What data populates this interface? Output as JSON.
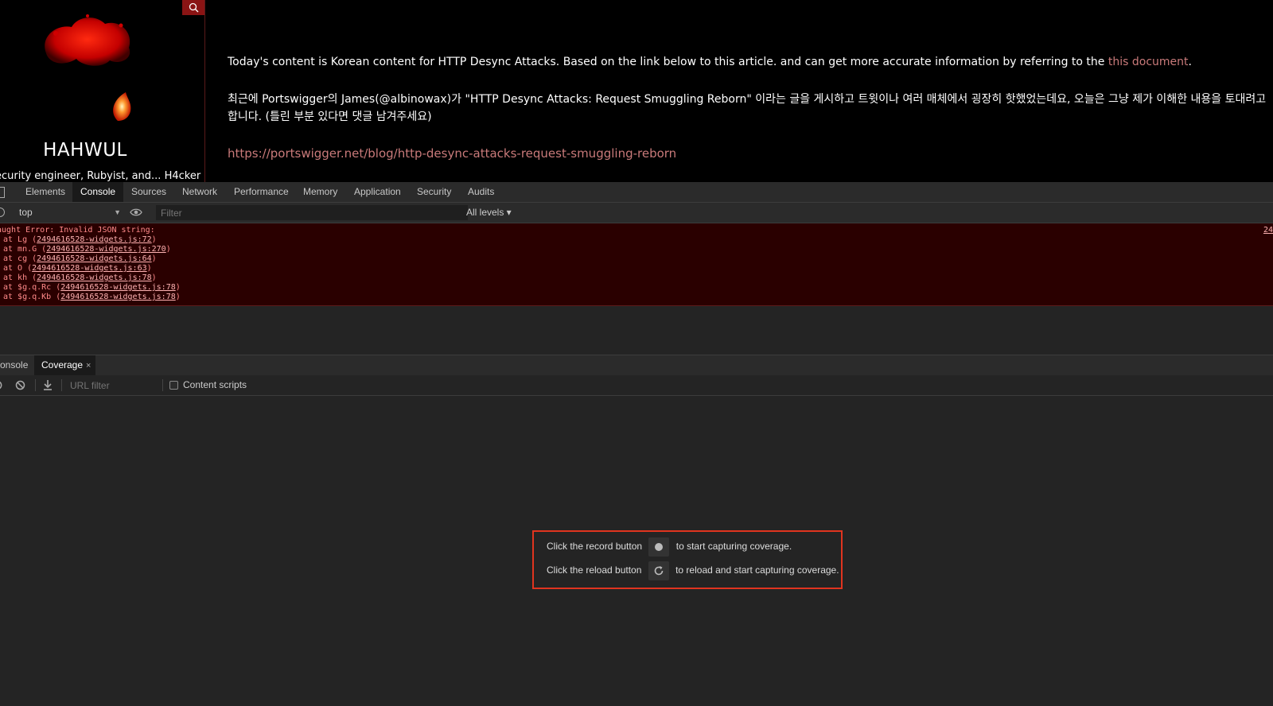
{
  "site": {
    "name": "HAHWUL",
    "tagline": "ecurity engineer, Rubyist, and... H4cker",
    "intro": "Today's content is Korean content for HTTP Desync Attacks. Based on the link below to this article. and can get more accurate information by referring to the",
    "intro_link": "this document",
    "intro_end": ".",
    "korean": "최근에 Portswigger의 James(@albinowax)가 \"HTTP Desync Attacks: Request Smuggling Reborn\" 이라는 글을 게시하고 트윗이나 여러 매체에서 굉장히 핫했었는데요, 오늘은 그냥 제가 이해한 내용을 토대려고 합니다. (틀린 부분 있다면 댓글 남겨주세요)",
    "link": "https://portswigger.net/blog/http-desync-attacks-request-smuggling-reborn"
  },
  "devtools": {
    "tabs": [
      "Elements",
      "Console",
      "Sources",
      "Network",
      "Performance",
      "Memory",
      "Application",
      "Security",
      "Audits"
    ],
    "active_tab": "Console"
  },
  "console": {
    "context": "top",
    "filter_placeholder": "Filter",
    "levels": "All levels ▾",
    "error": {
      "message": "aught Error: Invalid JSON string:",
      "line_ref": "24",
      "frames": [
        {
          "prefix": "at Lg (",
          "src": "2494616528-widgets.js:72",
          "suffix": ")"
        },
        {
          "prefix": "at mn.G (",
          "src": "2494616528-widgets.js:270",
          "suffix": ")"
        },
        {
          "prefix": "at cg (",
          "src": "2494616528-widgets.js:64",
          "suffix": ")"
        },
        {
          "prefix": "at O (",
          "src": "2494616528-widgets.js:63",
          "suffix": ")"
        },
        {
          "prefix": "at kh (",
          "src": "2494616528-widgets.js:78",
          "suffix": ")"
        },
        {
          "prefix": "at $g.q.Rc (",
          "src": "2494616528-widgets.js:78",
          "suffix": ")"
        },
        {
          "prefix": "at $g.q.Kb (",
          "src": "2494616528-widgets.js:78",
          "suffix": ")"
        }
      ]
    }
  },
  "drawer": {
    "tabs": [
      "onsole",
      "Coverage"
    ],
    "active_tab": "Coverage",
    "close_glyph": "×"
  },
  "coverage": {
    "url_filter_placeholder": "URL filter",
    "content_scripts_label": "Content scripts",
    "record_before": "Click the record button",
    "record_after": "to start capturing coverage.",
    "reload_before": "Click the reload button",
    "reload_after": "to reload and start capturing coverage."
  },
  "colors": {
    "error_bg": "#2a0000",
    "highlight": "#e0341f",
    "link": "#c97a7a"
  }
}
